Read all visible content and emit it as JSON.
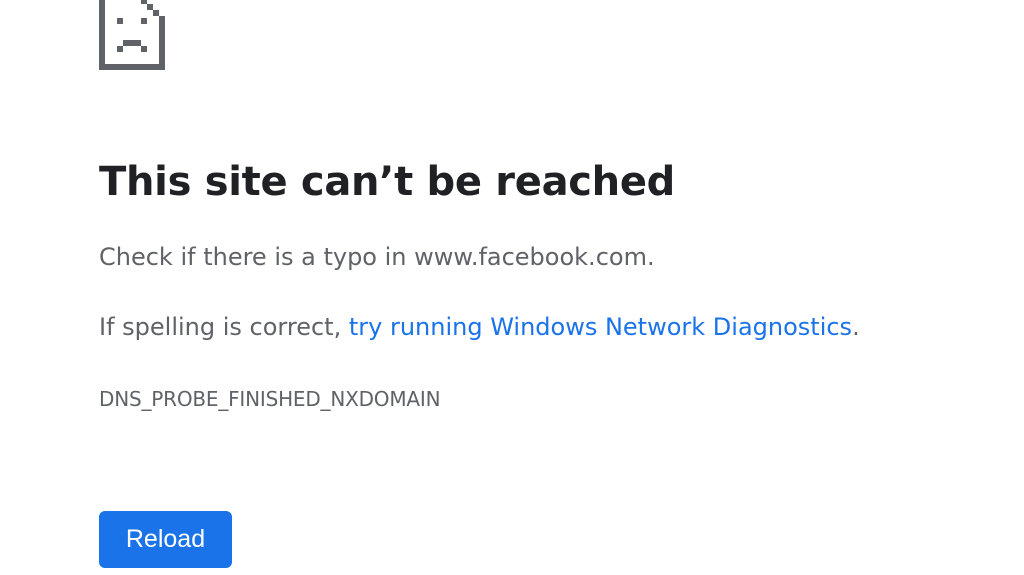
{
  "icon": {
    "name": "sad-document-icon",
    "color": "#5f6368"
  },
  "title": "This site can’t be reached",
  "message_typo": "Check if there is a typo in www.facebook.com.",
  "diagnostics": {
    "prefix": "If spelling is correct, ",
    "link_text": "try running Windows Network Diagnostics",
    "suffix": "."
  },
  "error_code": "DNS_PROBE_FINISHED_NXDOMAIN",
  "reload_label": "Reload",
  "colors": {
    "accent": "#1a73e8",
    "text_primary": "#202124",
    "text_secondary": "#5f6368",
    "background": "#ffffff"
  }
}
